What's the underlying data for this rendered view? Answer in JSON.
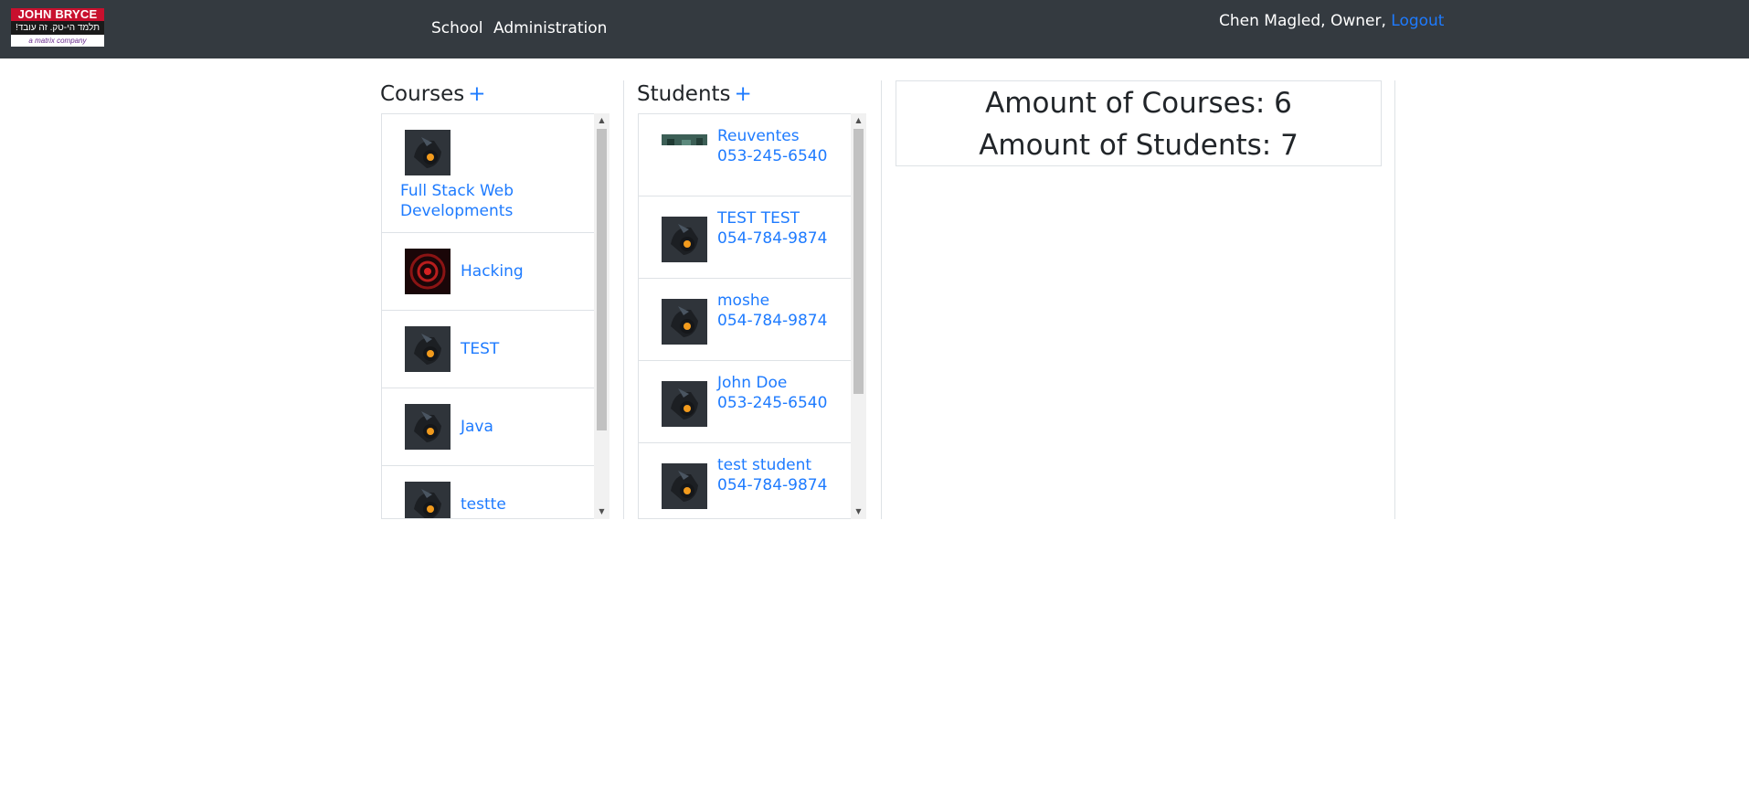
{
  "header": {
    "logo": {
      "line1": "JOHN BRYCE",
      "line2": "תלמד הי-טק. זה עובד!",
      "line3": "a matrix company"
    },
    "nav": [
      {
        "label": "School"
      },
      {
        "label": "Administration"
      }
    ],
    "user": {
      "greeting": "Chen Magled, Owner, ",
      "logout_label": "Logout"
    }
  },
  "courses": {
    "title": "Courses",
    "add_label": "+",
    "items": [
      {
        "name": "Full Stack Web Developments"
      },
      {
        "name": "Hacking"
      },
      {
        "name": "TEST"
      },
      {
        "name": "Java"
      },
      {
        "name": "testte"
      }
    ]
  },
  "students": {
    "title": "Students",
    "add_label": "+",
    "items": [
      {
        "name": "Reuventes",
        "phone": "053-245-6540"
      },
      {
        "name": "TEST TEST",
        "phone": "054-784-9874"
      },
      {
        "name": "moshe",
        "phone": "054-784-9874"
      },
      {
        "name": "John Doe",
        "phone": "053-245-6540"
      },
      {
        "name": "test student",
        "phone": "054-784-9874"
      }
    ]
  },
  "stats": {
    "courses_label": "Amount of Courses: 6",
    "students_label": "Amount of Students: 7"
  },
  "icons": {
    "scroll_up": "up-arrow-icon",
    "scroll_down": "down-arrow-icon",
    "course_image": "course-image-icon",
    "student_image": "student-avatar-icon"
  },
  "colors": {
    "topbar": "#343a40",
    "link": "#1e7bff",
    "logo_red": "#c8102e"
  }
}
